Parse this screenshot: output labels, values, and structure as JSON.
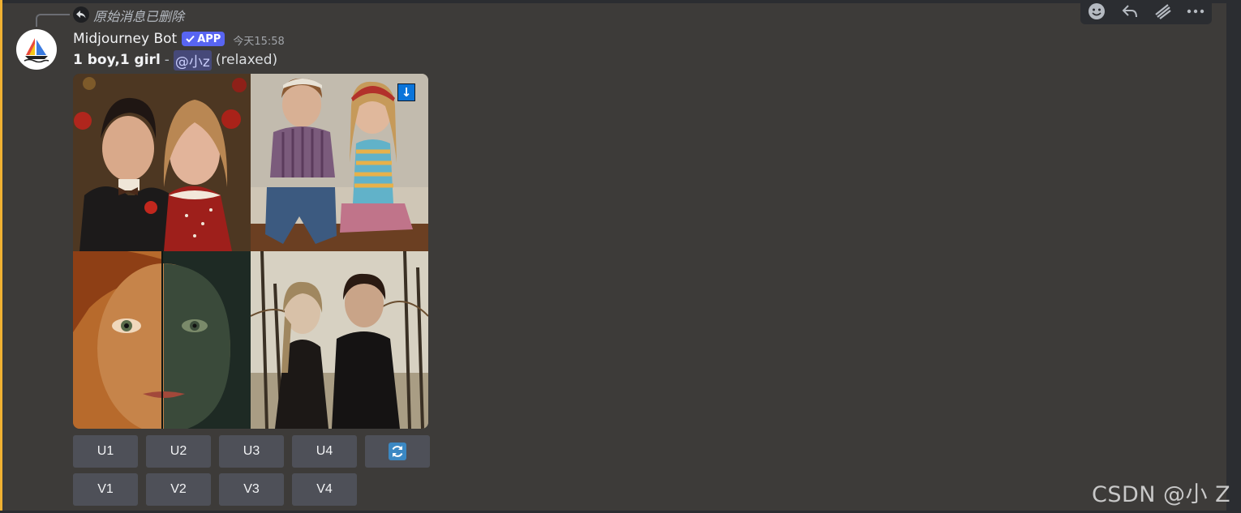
{
  "reply": {
    "text": "原始消息已删除"
  },
  "message": {
    "author": "Midjourney Bot",
    "badge": "APP",
    "timestamp": "今天15:58",
    "prompt": "1 boy,1 girl",
    "separator": "-",
    "mention": "@小z",
    "mode": "(relaxed)"
  },
  "download_label": "↓",
  "buttons": {
    "row1": [
      "U1",
      "U2",
      "U3",
      "U4"
    ],
    "row2": [
      "V1",
      "V2",
      "V3",
      "V4"
    ],
    "reroll_icon": "refresh-icon"
  },
  "toolbar_icons": [
    "emoji-icon",
    "reply-icon",
    "threads-icon",
    "more-icon"
  ],
  "watermark": "CSDN @小 Z",
  "colors": {
    "accent_bar": "#f0b132",
    "badge": "#5865f2",
    "button": "#4e5058",
    "background": "#3d3b39",
    "download_button": "#0a74da"
  }
}
